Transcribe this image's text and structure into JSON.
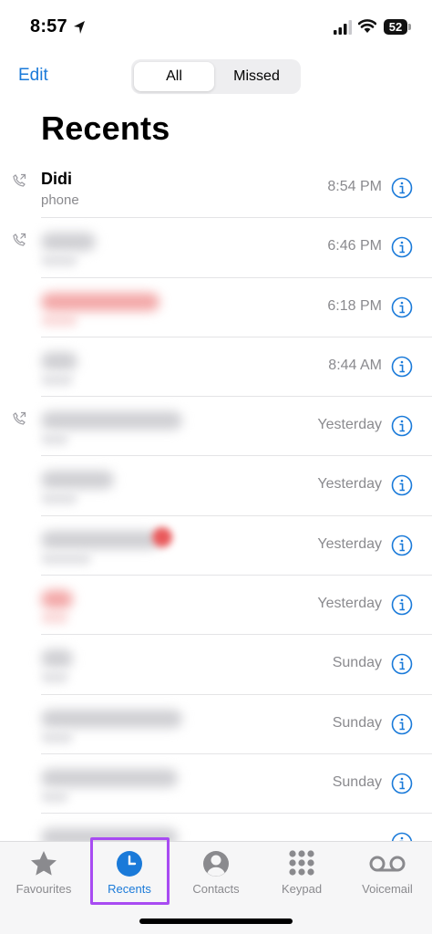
{
  "status_bar": {
    "time": "8:57",
    "battery": "52"
  },
  "nav": {
    "edit_label": "Edit",
    "segments": [
      "All",
      "Missed"
    ],
    "selected_segment": "All"
  },
  "page_title": "Recents",
  "recents": [
    {
      "name": "Didi",
      "subtitle": "phone",
      "time": "8:54 PM",
      "outgoing": true,
      "blurred": false,
      "missed": false
    },
    {
      "name": "",
      "subtitle": "",
      "time": "6:46 PM",
      "outgoing": true,
      "blurred": true,
      "missed": false
    },
    {
      "name": "",
      "subtitle": "",
      "time": "6:18 PM",
      "outgoing": false,
      "blurred": true,
      "missed": true
    },
    {
      "name": "",
      "subtitle": "",
      "time": "8:44 AM",
      "outgoing": false,
      "blurred": true,
      "missed": false
    },
    {
      "name": "",
      "subtitle": "",
      "time": "Yesterday",
      "outgoing": true,
      "blurred": true,
      "missed": false
    },
    {
      "name": "",
      "subtitle": "",
      "time": "Yesterday",
      "outgoing": false,
      "blurred": true,
      "missed": false
    },
    {
      "name": "",
      "subtitle": "",
      "time": "Yesterday",
      "outgoing": false,
      "blurred": true,
      "missed": false
    },
    {
      "name": "",
      "subtitle": "",
      "time": "Yesterday",
      "outgoing": false,
      "blurred": true,
      "missed": true
    },
    {
      "name": "",
      "subtitle": "",
      "time": "Sunday",
      "outgoing": false,
      "blurred": true,
      "missed": false
    },
    {
      "name": "",
      "subtitle": "",
      "time": "Sunday",
      "outgoing": false,
      "blurred": true,
      "missed": false
    },
    {
      "name": "",
      "subtitle": "",
      "time": "Sunday",
      "outgoing": false,
      "blurred": true,
      "missed": false
    },
    {
      "name": "",
      "subtitle": "",
      "time": "",
      "outgoing": false,
      "blurred": true,
      "missed": false
    }
  ],
  "tabbar": {
    "tabs": [
      {
        "label": "Favourites",
        "icon": "star-icon"
      },
      {
        "label": "Recents",
        "icon": "clock-icon"
      },
      {
        "label": "Contacts",
        "icon": "person-icon"
      },
      {
        "label": "Keypad",
        "icon": "keypad-icon"
      },
      {
        "label": "Voicemail",
        "icon": "voicemail-icon"
      }
    ],
    "active": "Recents"
  },
  "colors": {
    "accent": "#1a7ad9",
    "secondary_text": "#8a8a8e",
    "highlight": "#a84bf2"
  }
}
